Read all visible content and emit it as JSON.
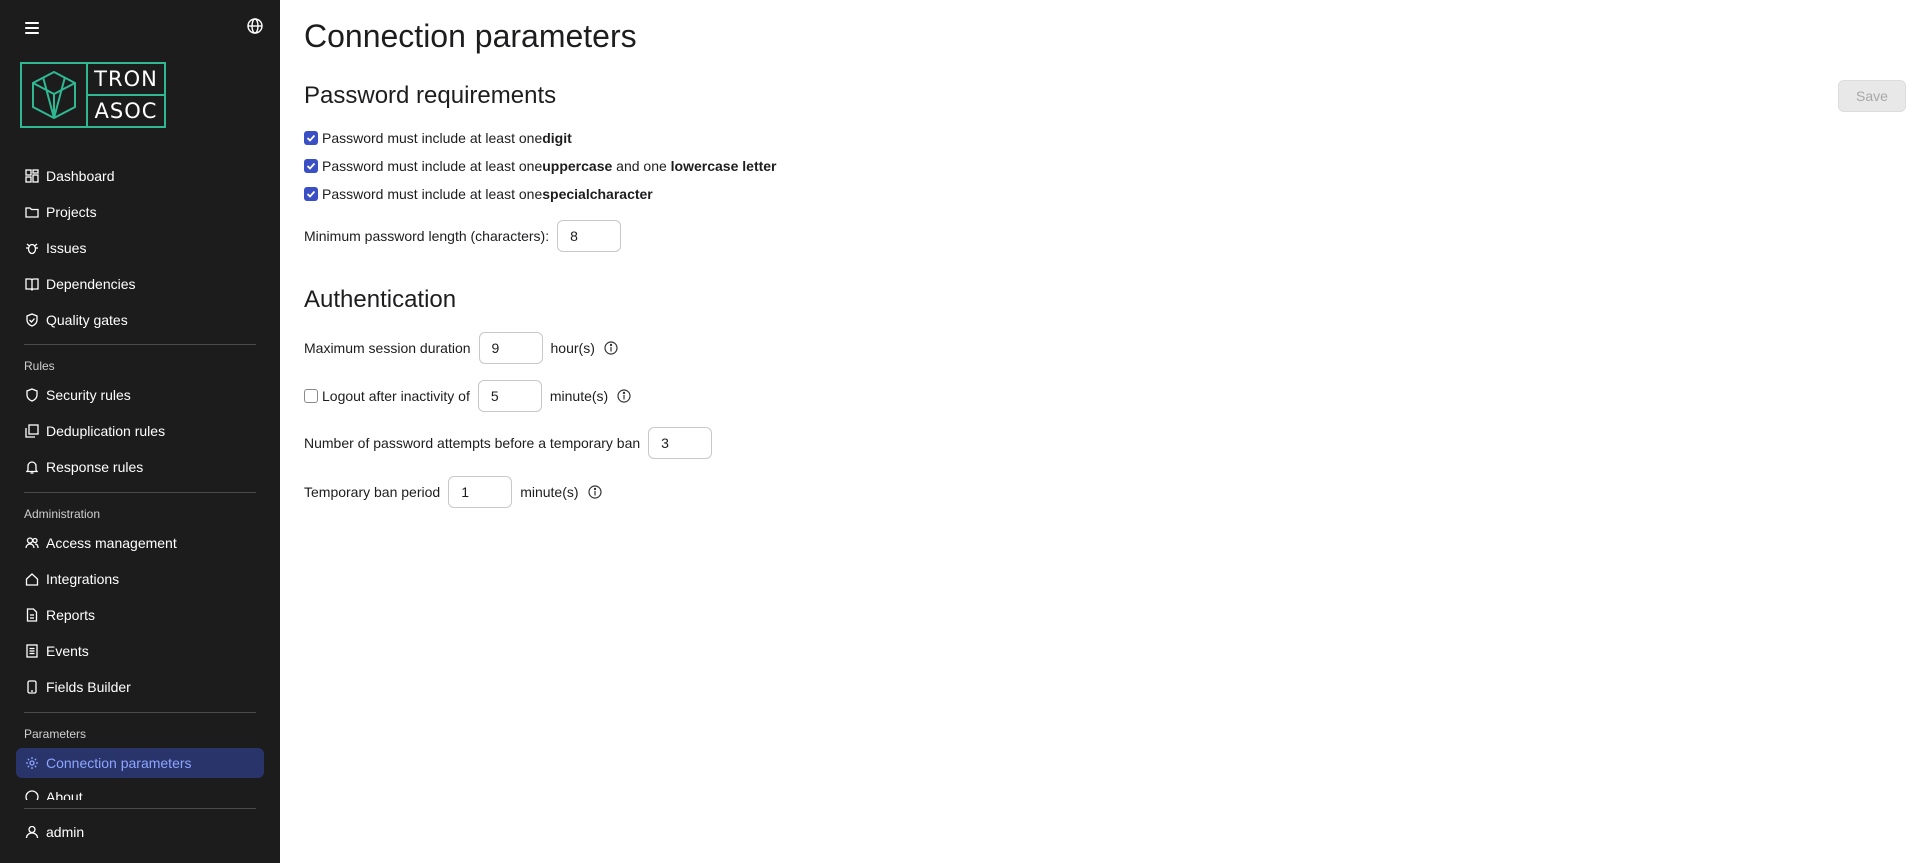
{
  "logo": {
    "line1": "TRON",
    "line2": "ASOC"
  },
  "sidebar": {
    "main_items": [
      {
        "label": "Dashboard",
        "icon": "dashboard-icon"
      },
      {
        "label": "Projects",
        "icon": "folder-icon"
      },
      {
        "label": "Issues",
        "icon": "bug-icon"
      },
      {
        "label": "Dependencies",
        "icon": "book-icon"
      },
      {
        "label": "Quality gates",
        "icon": "shield-check-icon"
      }
    ],
    "rules_section": "Rules",
    "rules_items": [
      {
        "label": "Security rules",
        "icon": "shield-icon"
      },
      {
        "label": "Deduplication rules",
        "icon": "copy-icon"
      },
      {
        "label": "Response rules",
        "icon": "bell-icon"
      }
    ],
    "admin_section": "Administration",
    "admin_items": [
      {
        "label": "Access management",
        "icon": "users-icon"
      },
      {
        "label": "Integrations",
        "icon": "home-icon"
      },
      {
        "label": "Reports",
        "icon": "file-icon"
      },
      {
        "label": "Events",
        "icon": "list-icon"
      },
      {
        "label": "Fields Builder",
        "icon": "phone-icon"
      }
    ],
    "params_section": "Parameters",
    "params_items": [
      {
        "label": "Connection parameters",
        "icon": "gear-icon",
        "active": true
      },
      {
        "label": "About",
        "icon": "info-icon"
      }
    ],
    "user": {
      "label": "admin",
      "icon": "user-icon"
    }
  },
  "page": {
    "title": "Connection parameters",
    "save_label": "Save"
  },
  "password": {
    "title": "Password requirements",
    "req_digit": {
      "checked": true,
      "prefix": "Password must include at least one ",
      "bold": "digit"
    },
    "req_case": {
      "checked": true,
      "prefix": "Password must include at least one ",
      "bold1": "uppercase",
      "mid": " and one ",
      "bold2": "lowercase letter"
    },
    "req_special": {
      "checked": true,
      "prefix": "Password must include at least one ",
      "bold": "specialcharacter"
    },
    "min_length_label": "Minimum password length (characters):",
    "min_length_value": "8"
  },
  "auth": {
    "title": "Authentication",
    "session_label": "Maximum session duration",
    "session_value": "9",
    "session_unit": "hour(s)",
    "logout_checked": false,
    "logout_label": "Logout after inactivity of",
    "logout_value": "5",
    "logout_unit": "minute(s)",
    "attempts_label": "Number of password attempts before a temporary ban",
    "attempts_value": "3",
    "ban_label": "Temporary ban period",
    "ban_value": "1",
    "ban_unit": "minute(s)"
  },
  "colors": {
    "sidebar_bg": "#1c1c1c",
    "accent": "#3b4fc5",
    "active_bg": "#28346a",
    "active_text": "#8da5ff",
    "logo": "#2fb892"
  }
}
